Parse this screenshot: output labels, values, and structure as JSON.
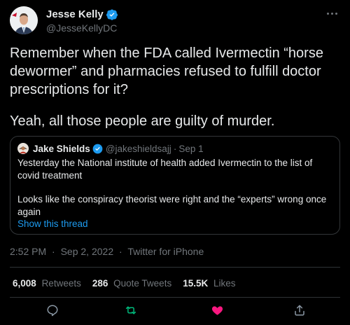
{
  "tweet": {
    "author_name": "Jesse Kelly",
    "author_handle": "@JesseKellyDC",
    "text_paragraphs": [
      "Remember when the FDA called Ivermectin “horse dewormer” and pharmacies refused to fulfill doctor prescriptions for it?",
      "Yeah, all those people are guilty of murder."
    ],
    "time": "2:52 PM",
    "date": "Sep 2, 2022",
    "source": "Twitter for iPhone"
  },
  "quote": {
    "author_name": "Jake Shields",
    "author_handle": "@jakeshieldsajj",
    "date": "Sep 1",
    "text_paragraphs": [
      "Yesterday the National institute of health added Ivermectin to the list of covid treatment",
      "Looks like the conspiracy theorist were right  and the “experts” wrong once again"
    ],
    "thread_link": "Show this thread"
  },
  "stats": {
    "retweets_count": "6,008",
    "retweets_label": "Retweets",
    "quotes_count": "286",
    "quotes_label": "Quote Tweets",
    "likes_count": "15.5K",
    "likes_label": "Likes"
  },
  "separator": "·",
  "colors": {
    "background": "#000000",
    "text": "#e7e9ea",
    "muted": "#71767b",
    "link": "#1d9bf0",
    "verified": "#1d9bf0",
    "retweet": "#00ba7c",
    "like": "#f91880",
    "border": "#2f3336"
  },
  "icons": {
    "verified": "verified-badge-icon",
    "more": "more-options-icon",
    "reply": "reply-icon",
    "retweet": "retweet-icon",
    "like": "like-icon",
    "share": "share-icon"
  }
}
